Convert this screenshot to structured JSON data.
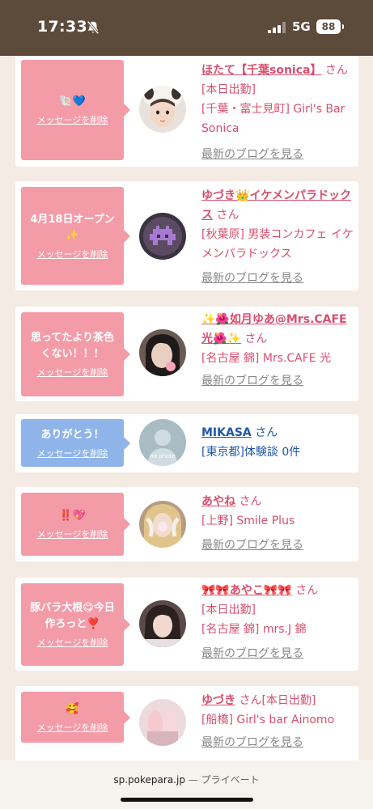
{
  "status": {
    "time": "17:33",
    "network": "5G",
    "battery": "88"
  },
  "delete_label": "メッセージを削除",
  "blog_label": "最新のブログを見る",
  "san": "さん",
  "cards": [
    {
      "message": "🐚💙",
      "name": "ほたて【千葉sonica】",
      "lines": [
        "[本日出勤]",
        "[千葉・富士見町] Girl's Bar Sonica"
      ],
      "blog": true
    },
    {
      "message": "4月18日オープン✨",
      "name": "ゆづき👑イケメンパラドックス",
      "lines": [
        "[秋葉原] 男装コンカフェ イケメンパラドックス"
      ],
      "blog": true
    },
    {
      "message": "思ってたより茶色くない！！！",
      "name": "✨🌺如月ゆあ@Mrs.CAFE光🌺✨",
      "lines": [
        "[名古屋 錦] Mrs.CAFE 光"
      ],
      "blog": true
    },
    {
      "message": "ありがとう！",
      "name": "MIKASA",
      "lines": [
        "[東京都]体験談 0件"
      ],
      "blog": false
    },
    {
      "message": "‼️💖",
      "name": "あやね",
      "lines": [
        "[上野] Smile Plus"
      ],
      "blog": true
    },
    {
      "message": "豚バラ大根😋今日作ろっと❣️",
      "name": "🎀🎀あやこ🎀🎀",
      "lines": [
        "[本日出勤]",
        "[名古屋 錦] mrs.J 錦"
      ],
      "blog": true
    },
    {
      "message": "🥰",
      "name": "ゆづき",
      "lines": [
        "[本日出勤]",
        "[船橋] Girl's bar Ainomo"
      ],
      "blog": true
    }
  ],
  "browser": {
    "domain": "sp.pokepara.jp",
    "separator": "—",
    "mode": "プライベート"
  },
  "colors": {
    "header_bg": "#5c4a3a",
    "page_bg": "#f4ece4",
    "pink_bubble": "#f49ba8",
    "blue_bubble": "#8fb4ea",
    "name_pink": "#d84f6e",
    "name_blue": "#1f57a6"
  }
}
